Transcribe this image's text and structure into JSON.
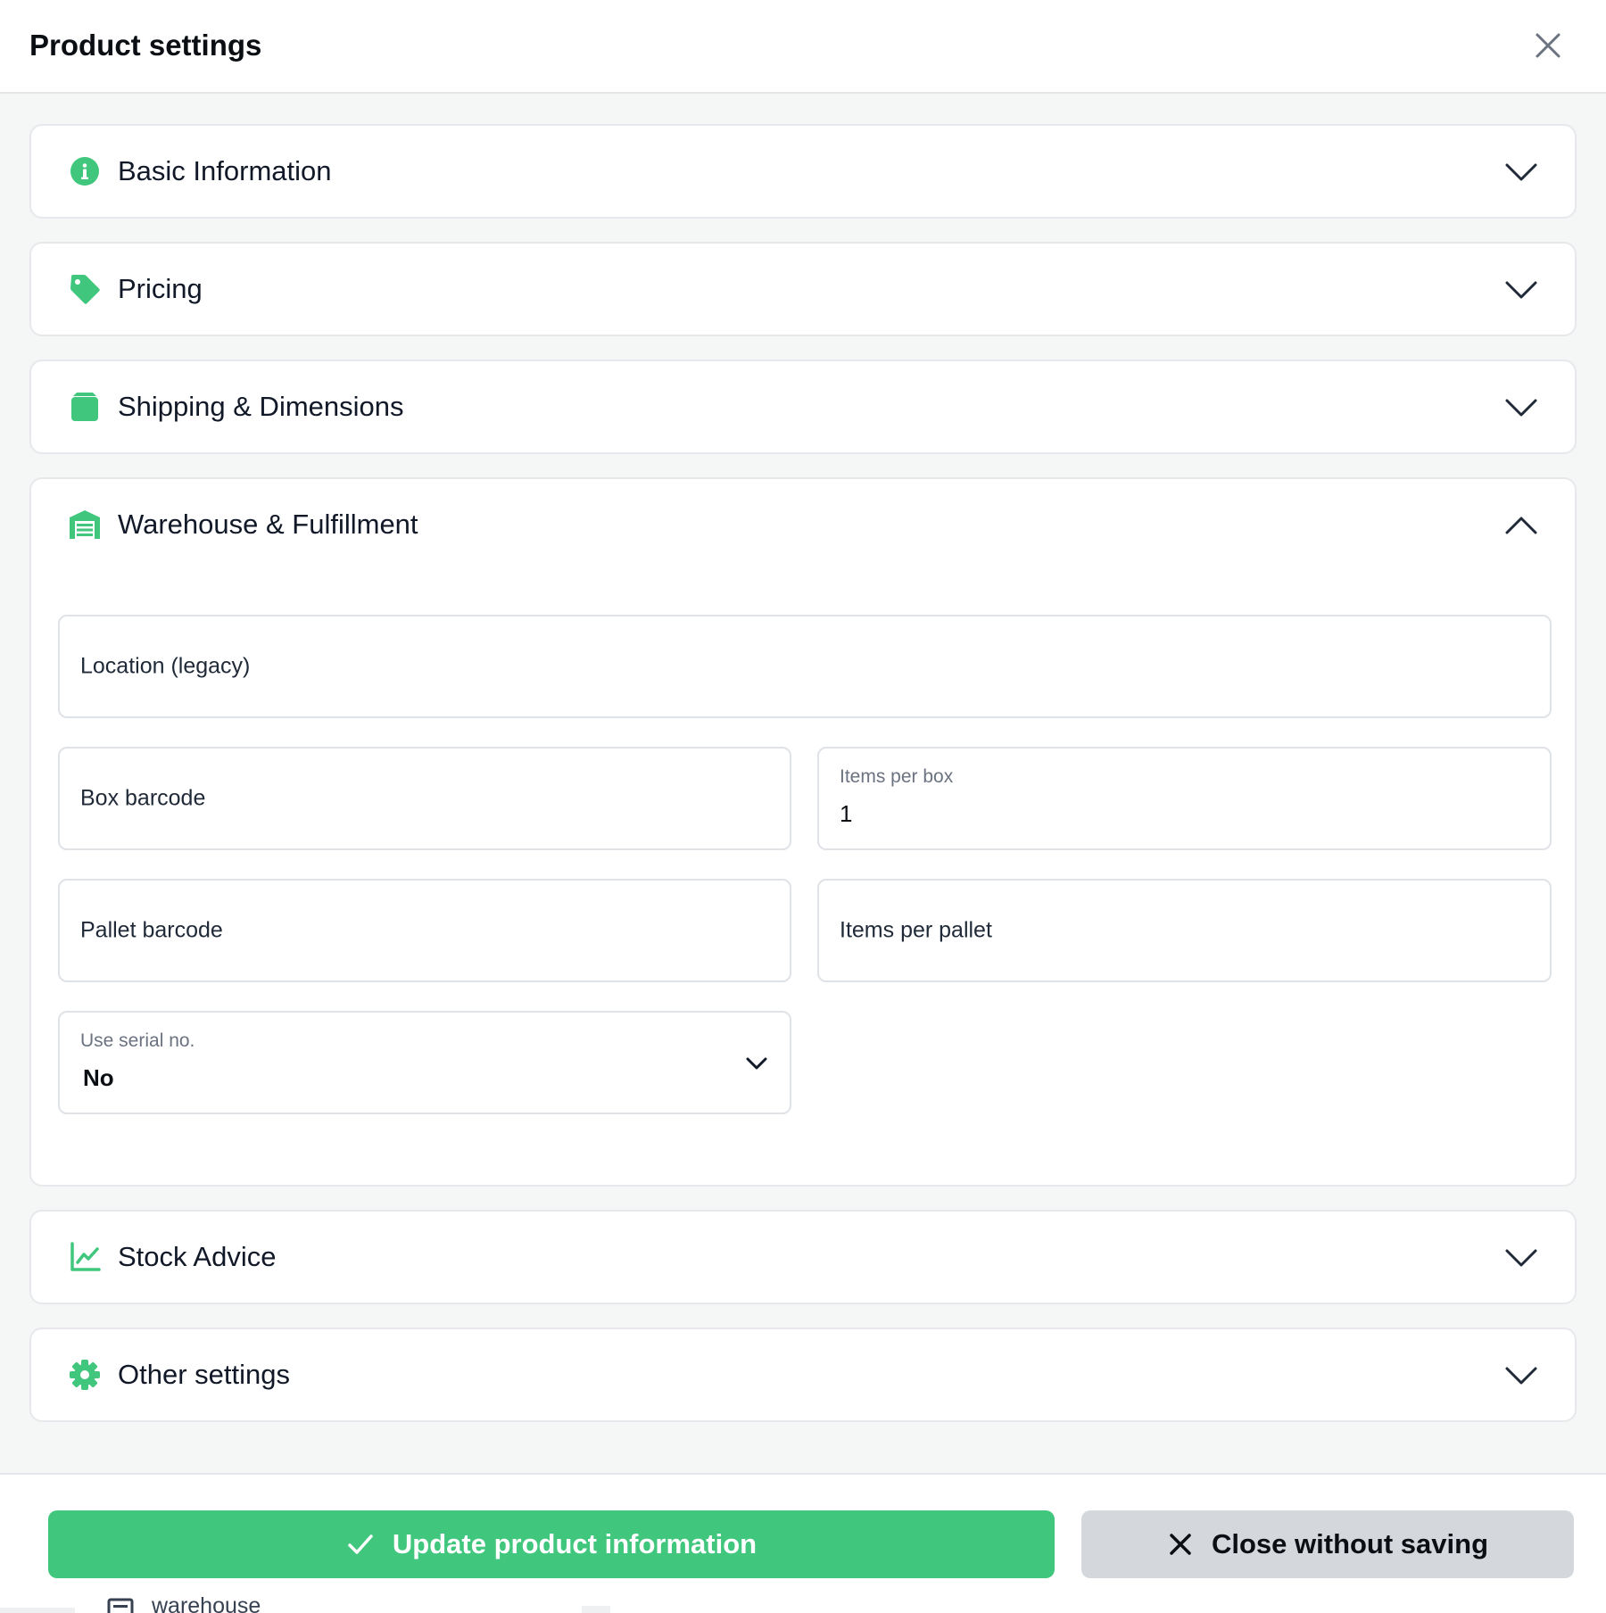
{
  "header": {
    "title": "Product settings"
  },
  "sections": {
    "basic": {
      "title": "Basic Information"
    },
    "pricing": {
      "title": "Pricing"
    },
    "shipping": {
      "title": "Shipping & Dimensions"
    },
    "warehouse": {
      "title": "Warehouse & Fulfillment",
      "fields": {
        "location": {
          "label": "Location (legacy)"
        },
        "box_barcode": {
          "label": "Box barcode"
        },
        "items_per_box": {
          "label": "Items per box",
          "value": "1"
        },
        "pallet_barcode": {
          "label": "Pallet barcode"
        },
        "items_per_pallet": {
          "label": "Items per pallet"
        },
        "use_serial": {
          "label": "Use serial no.",
          "value": "No"
        }
      }
    },
    "stock": {
      "title": "Stock Advice"
    },
    "other": {
      "title": "Other settings"
    }
  },
  "footer": {
    "update_label": "Update product information",
    "close_label": "Close without saving"
  },
  "underlay": {
    "text": "warehouse"
  },
  "colors": {
    "accent": "#41c77d",
    "secondary": "#d4d7dc",
    "border": "#e6e8eb"
  },
  "icons": {
    "basic": "info-circle-icon",
    "pricing": "tag-icon",
    "shipping": "box-icon",
    "warehouse": "warehouse-icon",
    "stock": "chart-line-icon",
    "other": "gear-icon"
  }
}
